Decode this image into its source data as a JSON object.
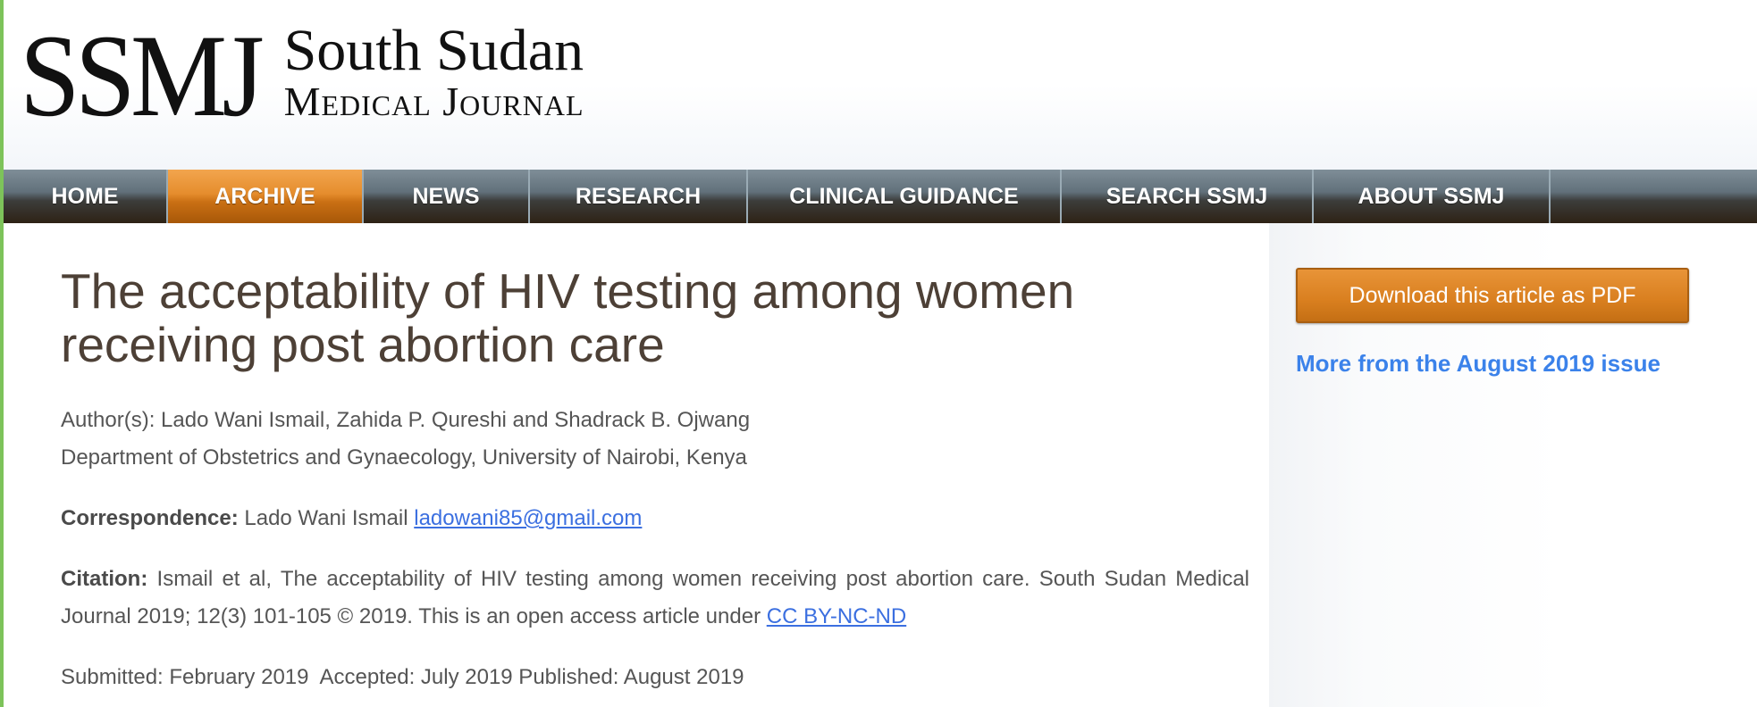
{
  "logo": {
    "mark": "SSMJ",
    "line1": "South Sudan",
    "line2": "Medical Journal"
  },
  "nav": {
    "items": [
      {
        "label": "HOME",
        "active": false
      },
      {
        "label": "ARCHIVE",
        "active": true
      },
      {
        "label": "NEWS",
        "active": false
      },
      {
        "label": "RESEARCH",
        "active": false
      },
      {
        "label": "CLINICAL GUIDANCE",
        "active": false
      },
      {
        "label": "SEARCH SSMJ",
        "active": false
      },
      {
        "label": "ABOUT SSMJ",
        "active": false
      }
    ]
  },
  "article": {
    "title": "The acceptability of HIV testing among women receiving post abortion care",
    "authors": "Author(s): Lado Wani Ismail, Zahida P. Qureshi and Shadrack B. Ojwang",
    "department": "Department of Obstetrics and Gynaecology, University of Nairobi, Kenya",
    "correspondence_label": "Correspondence:",
    "correspondence_name": " Lado Wani Ismail ",
    "correspondence_email": "ladowani85@gmail.com",
    "citation_label": "Citation:",
    "citation_text": " Ismail et al, The acceptability of HIV testing among women receiving post abortion care. South Sudan Medical Journal 2019; 12(3) 101-105 © 2019. This is an open access article under ",
    "license_link": "CC BY-NC-ND",
    "dates": "Submitted: February 2019  Accepted: July 2019 Published: August 2019"
  },
  "sidebar": {
    "download_button": "Download this article as PDF",
    "more_link": "More from the August 2019 issue"
  },
  "colors": {
    "nav_active": "#e38b2b",
    "title": "#4d4036",
    "link": "#3b6fe0",
    "sidebar_link": "#3b82ea",
    "button": "#d97f1f",
    "left_edge": "#7dc35a"
  }
}
